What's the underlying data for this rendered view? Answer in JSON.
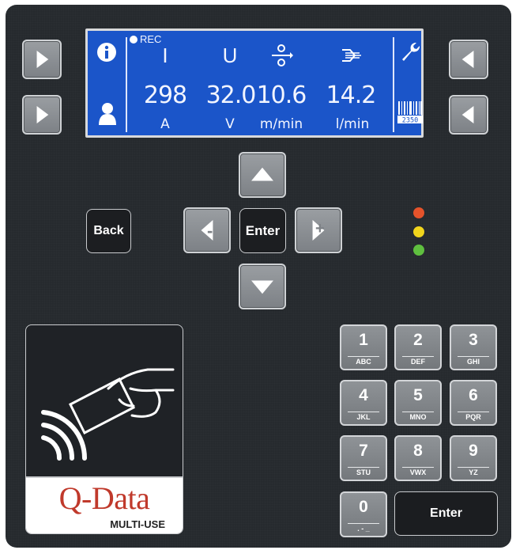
{
  "display": {
    "rec_label": "REC",
    "columns": [
      {
        "symbol": "I",
        "value": "298",
        "unit": "A"
      },
      {
        "symbol": "U",
        "value": "32.0",
        "unit": "V"
      },
      {
        "symbol_icon": "wire-feed-icon",
        "value": "10.6",
        "unit": "m/min"
      },
      {
        "symbol_icon": "gas-flow-icon",
        "value": "14.2",
        "unit": "l/min"
      }
    ],
    "barcode_number": "2350",
    "left_icons": [
      "info-icon",
      "user-icon"
    ],
    "right_icons": [
      "wrench-icon",
      "barcode-icon"
    ]
  },
  "nav": {
    "back_label": "Back",
    "enter_label": "Enter",
    "minus_label": "-",
    "plus_label": "+"
  },
  "leds": {
    "colors": [
      "#e5532b",
      "#f1d51c",
      "#5fbf3f"
    ]
  },
  "logo": {
    "brand": "Q-Data",
    "sub": "MULTI-USE",
    "brand_color": "#c0392b"
  },
  "keypad": {
    "keys": [
      {
        "num": "1",
        "letters": "ABC"
      },
      {
        "num": "2",
        "letters": "DEF"
      },
      {
        "num": "3",
        "letters": "GHI"
      },
      {
        "num": "4",
        "letters": "JKL"
      },
      {
        "num": "5",
        "letters": "MNO"
      },
      {
        "num": "6",
        "letters": "PQR"
      },
      {
        "num": "7",
        "letters": "STU"
      },
      {
        "num": "8",
        "letters": "VWX"
      },
      {
        "num": "9",
        "letters": "YZ"
      },
      {
        "num": "0",
        "letters": ". - _"
      }
    ],
    "enter_label": "Enter"
  }
}
